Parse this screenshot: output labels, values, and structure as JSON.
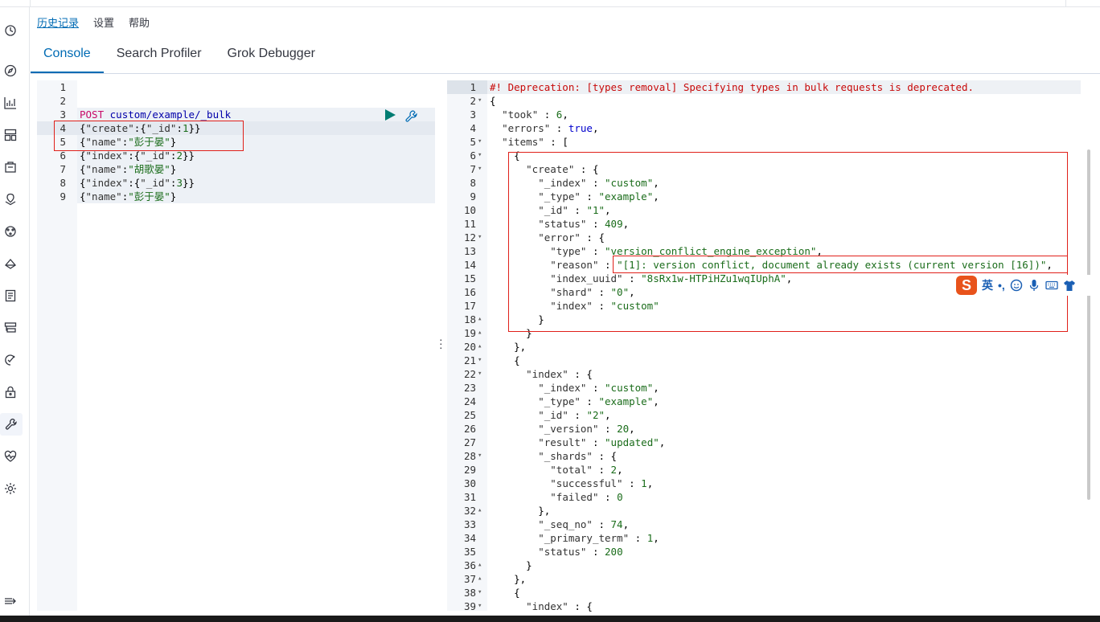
{
  "top_links": [
    "历史记录",
    "设置",
    "帮助"
  ],
  "tabs": [
    {
      "label": "Console",
      "selected": true
    },
    {
      "label": "Search Profiler",
      "selected": false
    },
    {
      "label": "Grok Debugger",
      "selected": false
    }
  ],
  "sidebar_icons": [
    "clock-icon",
    "compass-icon",
    "visualize-icon",
    "dashboard-icon",
    "canvas-icon",
    "maps-icon",
    "ml-icon",
    "infrastructure-icon",
    "logs-icon",
    "apm-icon",
    "uptime-icon",
    "siem-icon",
    "dev-tools-icon",
    "monitoring-icon",
    "management-icon",
    "collapse-icon"
  ],
  "request": {
    "line_numbers": [
      "1",
      "2",
      "3",
      "4",
      "5",
      "6",
      "7",
      "8",
      "9"
    ],
    "method": "POST",
    "url": "custom/example/_bulk",
    "lines": [
      "",
      "",
      "",
      "{\"create\":{\"_id\":1}}",
      "{\"name\":\"彭于晏\"}",
      "{\"index\":{\"_id\":2}}",
      "{\"name\":\"胡歌晏\"}",
      "{\"index\":{\"_id\":3}}",
      "{\"name\":\"彭于晏\"}"
    ]
  },
  "response": {
    "lines": [
      {
        "n": "1",
        "t": "#! Deprecation: [types removal] Specifying types in bulk requests is deprecated.",
        "fold": ""
      },
      {
        "n": "2",
        "t": "{",
        "fold": "▾"
      },
      {
        "n": "3",
        "t": "  \"took\" : 6,",
        "fold": ""
      },
      {
        "n": "4",
        "t": "  \"errors\" : true,",
        "fold": ""
      },
      {
        "n": "5",
        "t": "  \"items\" : [",
        "fold": "▾"
      },
      {
        "n": "6",
        "t": "    {",
        "fold": "▾"
      },
      {
        "n": "7",
        "t": "      \"create\" : {",
        "fold": "▾"
      },
      {
        "n": "8",
        "t": "        \"_index\" : \"custom\",",
        "fold": ""
      },
      {
        "n": "9",
        "t": "        \"_type\" : \"example\",",
        "fold": ""
      },
      {
        "n": "10",
        "t": "        \"_id\" : \"1\",",
        "fold": ""
      },
      {
        "n": "11",
        "t": "        \"status\" : 409,",
        "fold": ""
      },
      {
        "n": "12",
        "t": "        \"error\" : {",
        "fold": "▾"
      },
      {
        "n": "13",
        "t": "          \"type\" : \"version_conflict_engine_exception\",",
        "fold": ""
      },
      {
        "n": "14",
        "t": "          \"reason\" : \"[1]: version conflict, document already exists (current version [16])\",",
        "fold": ""
      },
      {
        "n": "15",
        "t": "          \"index_uuid\" : \"8sRx1w-HTPiHZu1wqIUphA\",",
        "fold": ""
      },
      {
        "n": "16",
        "t": "          \"shard\" : \"0\",",
        "fold": ""
      },
      {
        "n": "17",
        "t": "          \"index\" : \"custom\"",
        "fold": ""
      },
      {
        "n": "18",
        "t": "        }",
        "fold": "▴"
      },
      {
        "n": "19",
        "t": "      }",
        "fold": "▴"
      },
      {
        "n": "20",
        "t": "    },",
        "fold": "▴"
      },
      {
        "n": "21",
        "t": "    {",
        "fold": "▾"
      },
      {
        "n": "22",
        "t": "      \"index\" : {",
        "fold": "▾"
      },
      {
        "n": "23",
        "t": "        \"_index\" : \"custom\",",
        "fold": ""
      },
      {
        "n": "24",
        "t": "        \"_type\" : \"example\",",
        "fold": ""
      },
      {
        "n": "25",
        "t": "        \"_id\" : \"2\",",
        "fold": ""
      },
      {
        "n": "26",
        "t": "        \"_version\" : 20,",
        "fold": ""
      },
      {
        "n": "27",
        "t": "        \"result\" : \"updated\",",
        "fold": ""
      },
      {
        "n": "28",
        "t": "        \"_shards\" : {",
        "fold": "▾"
      },
      {
        "n": "29",
        "t": "          \"total\" : 2,",
        "fold": ""
      },
      {
        "n": "30",
        "t": "          \"successful\" : 1,",
        "fold": ""
      },
      {
        "n": "31",
        "t": "          \"failed\" : 0",
        "fold": ""
      },
      {
        "n": "32",
        "t": "        },",
        "fold": "▴"
      },
      {
        "n": "33",
        "t": "        \"_seq_no\" : 74,",
        "fold": ""
      },
      {
        "n": "34",
        "t": "        \"_primary_term\" : 1,",
        "fold": ""
      },
      {
        "n": "35",
        "t": "        \"status\" : 200",
        "fold": ""
      },
      {
        "n": "36",
        "t": "      }",
        "fold": "▴"
      },
      {
        "n": "37",
        "t": "    },",
        "fold": "▴"
      },
      {
        "n": "38",
        "t": "    {",
        "fold": "▾"
      },
      {
        "n": "39",
        "t": "      \"index\" : {",
        "fold": "▾"
      }
    ]
  },
  "ime": {
    "logo": "S",
    "mode": "英",
    "punct": "•,"
  },
  "colors": {
    "accent": "#006bb4",
    "highlight_box": "#e0201a",
    "method": "#c80a68",
    "string": "#1a6c1a",
    "comment": "#c80a0a"
  }
}
